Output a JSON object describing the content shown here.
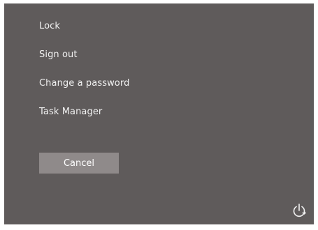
{
  "menu": {
    "items": [
      {
        "label": "Lock"
      },
      {
        "label": "Sign out"
      },
      {
        "label": "Change a password"
      },
      {
        "label": "Task Manager"
      }
    ]
  },
  "actions": {
    "cancel_label": "Cancel"
  },
  "icons": {
    "power": "power-icon"
  },
  "colors": {
    "panel_bg": "#5f5b5b",
    "text": "#f2f2f2",
    "button_bg": "#8f8a8a"
  }
}
